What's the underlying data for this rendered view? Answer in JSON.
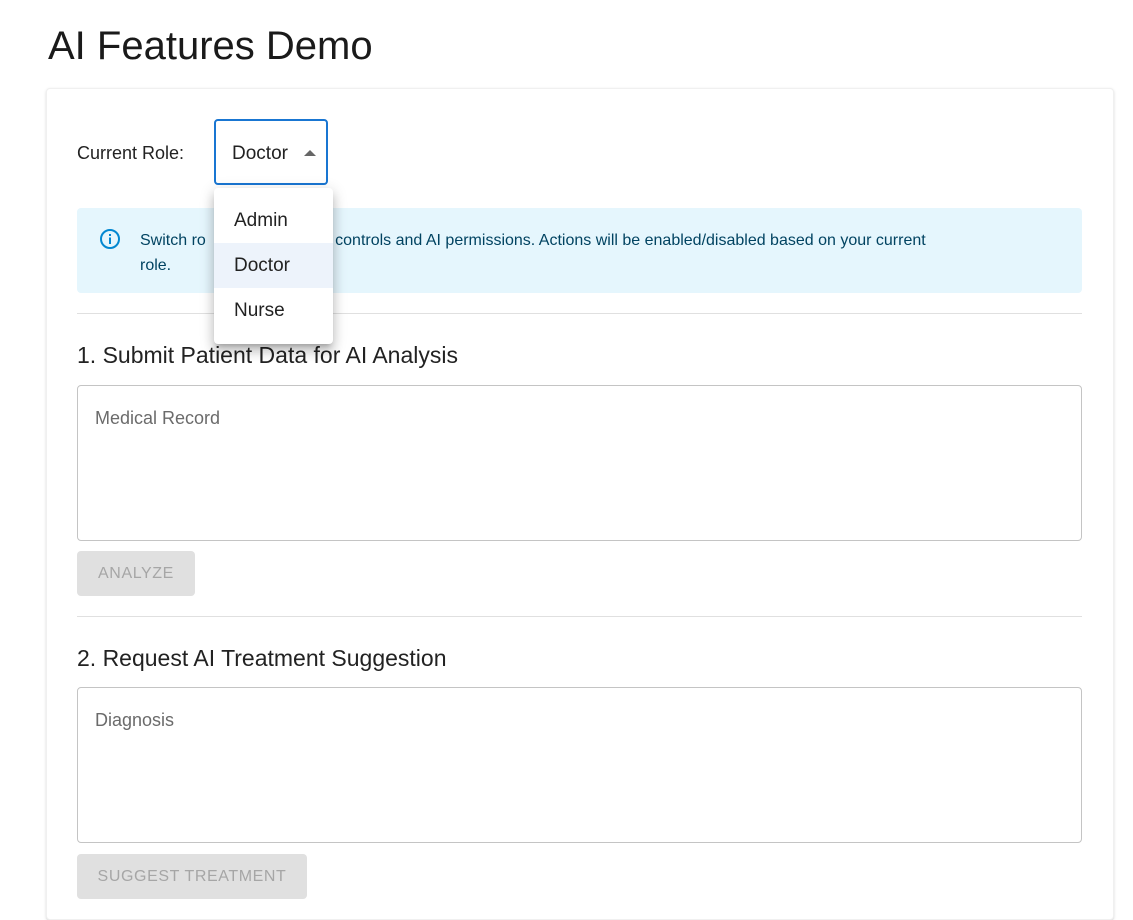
{
  "page": {
    "title": "AI Features Demo"
  },
  "role": {
    "label": "Current Role:",
    "selected": "Doctor",
    "options": [
      "Admin",
      "Doctor",
      "Nurse"
    ]
  },
  "alert": {
    "text_left": "Switch ro",
    "text_right": "ess controls and AI permissions. Actions will be enabled/disabled based on your current",
    "text_line2": "role.",
    "color_bg": "#e5f6fd",
    "color_icon": "#0288d1"
  },
  "section1": {
    "title": "1. Submit Patient Data for AI Analysis",
    "placeholder": "Medical Record",
    "button": "ANALYZE"
  },
  "section2": {
    "title": "2. Request AI Treatment Suggestion",
    "placeholder": "Diagnosis",
    "button": "SUGGEST TREATMENT"
  },
  "colors": {
    "accent": "#1976d2",
    "disabled_bg": "#e0e0e0",
    "disabled_text": "#a6a6a6"
  }
}
